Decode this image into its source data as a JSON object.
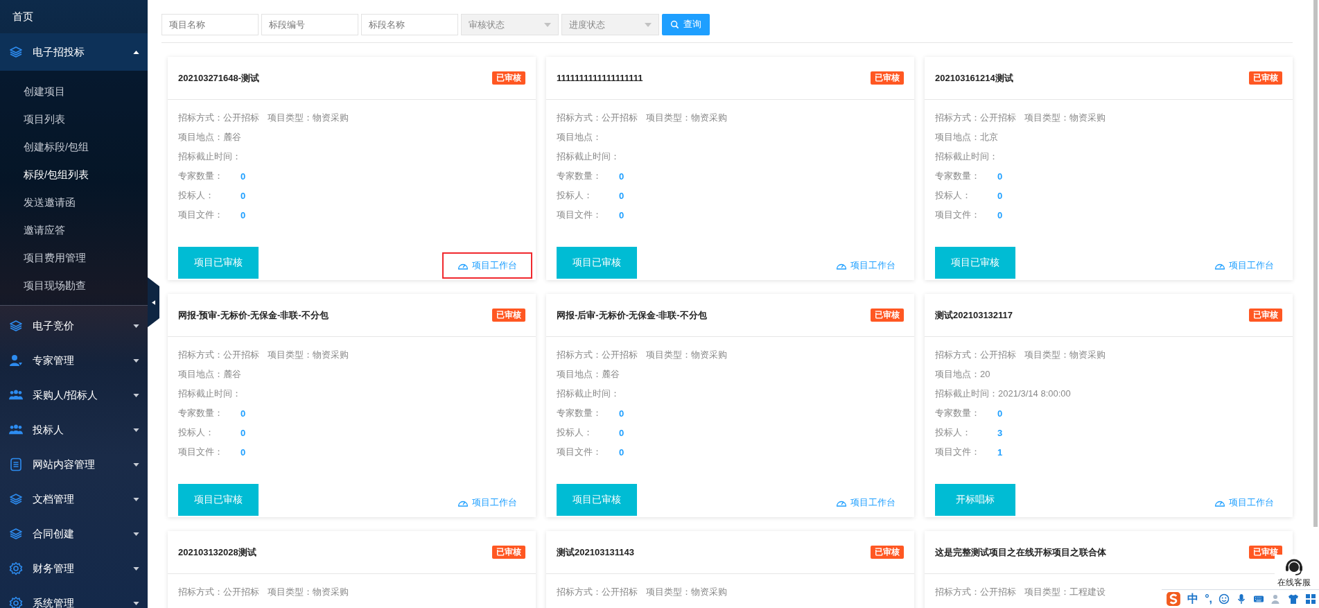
{
  "sidebar": {
    "home": "首页",
    "groups": [
      {
        "label": "电子招投标",
        "expanded": true,
        "items": [
          {
            "label": "创建项目",
            "selected": false
          },
          {
            "label": "项目列表",
            "selected": false
          },
          {
            "label": "创建标段/包组",
            "selected": false
          },
          {
            "label": "标段/包组列表",
            "selected": true
          },
          {
            "label": "发送邀请函",
            "selected": false
          },
          {
            "label": "邀请应答",
            "selected": false
          },
          {
            "label": "项目费用管理",
            "selected": false
          },
          {
            "label": "项目现场勘查",
            "selected": false
          }
        ]
      },
      {
        "label": "电子竞价",
        "expanded": false
      },
      {
        "label": "专家管理",
        "expanded": false
      },
      {
        "label": "采购人/招标人",
        "expanded": false
      },
      {
        "label": "投标人",
        "expanded": false
      },
      {
        "label": "网站内容管理",
        "expanded": false
      },
      {
        "label": "文档管理",
        "expanded": false
      },
      {
        "label": "合同创建",
        "expanded": false
      },
      {
        "label": "财务管理",
        "expanded": false
      },
      {
        "label": "系统管理",
        "expanded": false
      }
    ]
  },
  "filters": {
    "fields": [
      {
        "placeholder": "项目名称"
      },
      {
        "placeholder": "标段编号"
      },
      {
        "placeholder": "标段名称"
      }
    ],
    "selects": [
      {
        "placeholder": "审核状态"
      },
      {
        "placeholder": "进度状态"
      }
    ],
    "search_button": "查询"
  },
  "cards": [
    {
      "title": "202103271648-测试",
      "badge": "已审核",
      "method": {
        "label": "招标方式：",
        "value": "公开招标"
      },
      "type": {
        "label": "项目类型：",
        "value": "物资采购"
      },
      "fields": [
        {
          "kind": "text",
          "label": "项目地点：",
          "value": "麓谷"
        },
        {
          "kind": "text",
          "label": "招标截止时间："
        },
        {
          "kind": "count",
          "label": "专家数量：",
          "value": "0"
        },
        {
          "kind": "count",
          "label": "投标人：",
          "value": "0"
        },
        {
          "kind": "count",
          "label": "项目文件：",
          "value": "0"
        }
      ],
      "action": "项目已审核",
      "link": {
        "label": "项目工作台",
        "highlighted": true
      }
    },
    {
      "title": "1111111111111111111",
      "badge": "已审核",
      "method": {
        "label": "招标方式：",
        "value": "公开招标"
      },
      "type": {
        "label": "项目类型：",
        "value": "物资采购"
      },
      "fields": [
        {
          "kind": "text",
          "label": "项目地点："
        },
        {
          "kind": "text",
          "label": "招标截止时间："
        },
        {
          "kind": "count",
          "label": "专家数量：",
          "value": "0"
        },
        {
          "kind": "count",
          "label": "投标人：",
          "value": "0"
        },
        {
          "kind": "count",
          "label": "项目文件：",
          "value": "0"
        }
      ],
      "action": "项目已审核",
      "link": {
        "label": "项目工作台",
        "highlighted": false
      }
    },
    {
      "title": "202103161214测试",
      "badge": "已审核",
      "method": {
        "label": "招标方式：",
        "value": "公开招标"
      },
      "type": {
        "label": "项目类型：",
        "value": "物资采购"
      },
      "fields": [
        {
          "kind": "text",
          "label": "项目地点：",
          "value": "北京"
        },
        {
          "kind": "text",
          "label": "招标截止时间："
        },
        {
          "kind": "count",
          "label": "专家数量：",
          "value": "0"
        },
        {
          "kind": "count",
          "label": "投标人：",
          "value": "0"
        },
        {
          "kind": "count",
          "label": "项目文件：",
          "value": "0"
        }
      ],
      "action": "项目已审核",
      "link": {
        "label": "项目工作台",
        "highlighted": false
      }
    },
    {
      "title": "网报-预审-无标价-无保金-非联-不分包",
      "badge": "已审核",
      "method": {
        "label": "招标方式：",
        "value": "公开招标"
      },
      "type": {
        "label": "项目类型：",
        "value": "物资采购"
      },
      "fields": [
        {
          "kind": "text",
          "label": "项目地点：",
          "value": "麓谷"
        },
        {
          "kind": "text",
          "label": "招标截止时间："
        },
        {
          "kind": "count",
          "label": "专家数量：",
          "value": "0"
        },
        {
          "kind": "count",
          "label": "投标人：",
          "value": "0"
        },
        {
          "kind": "count",
          "label": "项目文件：",
          "value": "0"
        }
      ],
      "action": "项目已审核",
      "link": {
        "label": "项目工作台",
        "highlighted": false
      }
    },
    {
      "title": "网报-后审-无标价-无保金-非联-不分包",
      "badge": "已审核",
      "method": {
        "label": "招标方式：",
        "value": "公开招标"
      },
      "type": {
        "label": "项目类型：",
        "value": "物资采购"
      },
      "fields": [
        {
          "kind": "text",
          "label": "项目地点：",
          "value": "麓谷"
        },
        {
          "kind": "text",
          "label": "招标截止时间："
        },
        {
          "kind": "count",
          "label": "专家数量：",
          "value": "0"
        },
        {
          "kind": "count",
          "label": "投标人：",
          "value": "0"
        },
        {
          "kind": "count",
          "label": "项目文件：",
          "value": "0"
        }
      ],
      "action": "项目已审核",
      "link": {
        "label": "项目工作台",
        "highlighted": false
      }
    },
    {
      "title": "测试202103132117",
      "badge": "已审核",
      "method": {
        "label": "招标方式：",
        "value": "公开招标"
      },
      "type": {
        "label": "项目类型：",
        "value": "物资采购"
      },
      "fields": [
        {
          "kind": "text",
          "label": "项目地点：",
          "value": "20"
        },
        {
          "kind": "text",
          "label": "招标截止时间：",
          "value": "2021/3/14 8:00:00"
        },
        {
          "kind": "count",
          "label": "专家数量：",
          "value": "0"
        },
        {
          "kind": "count",
          "label": "投标人：",
          "value": "3"
        },
        {
          "kind": "count",
          "label": "项目文件：",
          "value": "1"
        }
      ],
      "action": "开标唱标",
      "link": {
        "label": "项目工作台",
        "highlighted": false
      }
    },
    {
      "title": "202103132028测试",
      "badge": "已审核",
      "method": {
        "label": "招标方式：",
        "value": "公开招标"
      },
      "type": {
        "label": "项目类型：",
        "value": "物资采购"
      }
    },
    {
      "title": "测试202103131143",
      "badge": "已审核",
      "method": {
        "label": "招标方式：",
        "value": "公开招标"
      },
      "type": {
        "label": "项目类型：",
        "value": "物资采购"
      }
    },
    {
      "title": "这是完整测试项目之在线开标项目之联合体",
      "badge": "已审核",
      "method": {
        "label": "招标方式：",
        "value": "公开招标"
      },
      "type": {
        "label": "项目类型：",
        "value": "工程建设"
      }
    }
  ],
  "service_widget": {
    "label": "在线客服"
  },
  "ime_toolbar": {
    "mode": "中",
    "punctuation": "°,"
  }
}
